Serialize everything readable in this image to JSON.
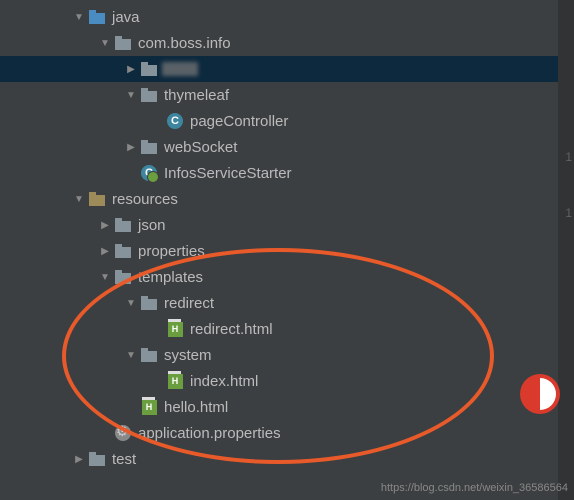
{
  "tree": {
    "java": "java",
    "comBossInfo": "com.boss.info",
    "thymeleaf": "thymeleaf",
    "pageController": "pageController",
    "webSocket": "webSocket",
    "infosServiceStarter": "InfosServiceStarter",
    "resources": "resources",
    "json": "json",
    "properties": "properties",
    "templates": "templates",
    "redirect": "redirect",
    "redirectHtml": "redirect.html",
    "system": "system",
    "indexHtml": "index.html",
    "helloHtml": "hello.html",
    "appProps": "application.properties",
    "test": "test"
  },
  "watermark": "https://blog.csdn.net/weixin_36586564",
  "rightNums": {
    "a": "1",
    "b": "1"
  }
}
